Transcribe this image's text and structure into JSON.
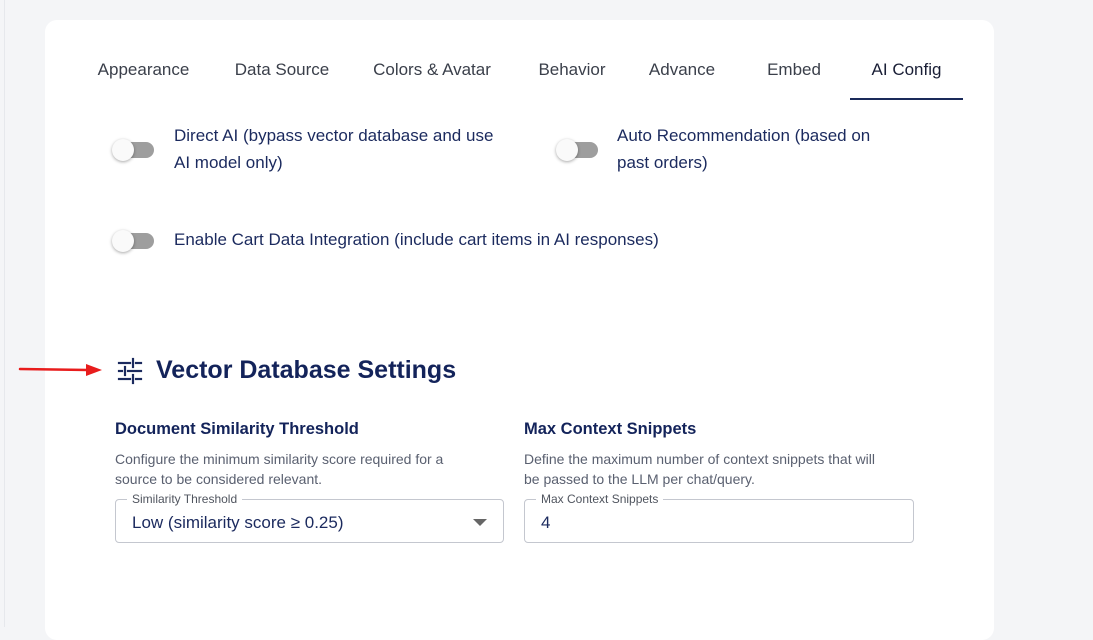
{
  "tabs": [
    {
      "label": "Appearance",
      "active": false
    },
    {
      "label": "Data Source",
      "active": false
    },
    {
      "label": "Colors & Avatar",
      "active": false
    },
    {
      "label": "Behavior",
      "active": false
    },
    {
      "label": "Advance",
      "active": false
    },
    {
      "label": "Embed",
      "active": false
    },
    {
      "label": "AI Config",
      "active": true
    }
  ],
  "toggles": {
    "direct_ai": {
      "line1": "Direct AI (bypass vector database and use",
      "line2": "AI model only)",
      "on": false
    },
    "auto_recommendation": {
      "line1": "Auto Recommendation (based on",
      "line2": "past orders)",
      "on": false
    },
    "cart_integration": {
      "line1": "Enable Cart Data Integration (include cart items in AI responses)",
      "on": false
    }
  },
  "section": {
    "title": "Vector Database Settings",
    "icon": "sliders-icon"
  },
  "similarity": {
    "title": "Document Similarity Threshold",
    "desc_line1": "Configure the minimum similarity score required for a",
    "desc_line2": "source to be considered relevant.",
    "legend": "Similarity Threshold",
    "value": "Low (similarity score ≥ 0.25)"
  },
  "snippets": {
    "title": "Max Context Snippets",
    "desc_line1": "Define the maximum number of context snippets that will",
    "desc_line2": "be passed to the LLM per chat/query.",
    "legend": "Max Context Snippets",
    "value": "4"
  },
  "colors": {
    "accent": "#13235a",
    "annotation_arrow": "#e81c1c",
    "toggle_off": "#9e9e9e"
  }
}
